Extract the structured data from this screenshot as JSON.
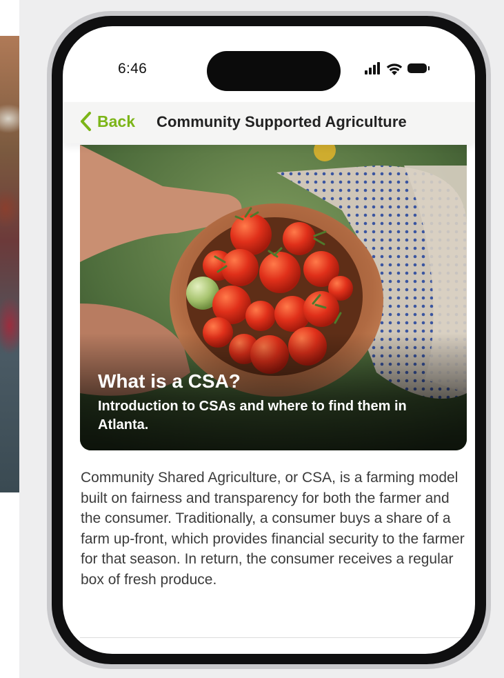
{
  "status_bar": {
    "time": "6:46"
  },
  "nav": {
    "back_label": "Back",
    "title": "Community Supported Agriculture"
  },
  "hero": {
    "title": "What is a CSA?",
    "subtitle": "Introduction to CSAs and where to find them in Atlanta."
  },
  "body": {
    "paragraph": "Community Shared Agriculture, or CSA, is a farming model built on fairness and transparency for both the farmer and the consumer. Traditionally, a consumer buys a share of a farm up-front, which provides financial security to the farmer for that season. In return, the consumer receives a regular box of fresh produce."
  },
  "colors": {
    "accent": "#7cb518",
    "text": "#3b3b3b",
    "nav_background": "#f5f5f4"
  },
  "icons": {
    "back": "chevron-left-icon",
    "signal": "cellular-signal-icon",
    "wifi": "wifi-icon",
    "battery": "battery-icon"
  }
}
